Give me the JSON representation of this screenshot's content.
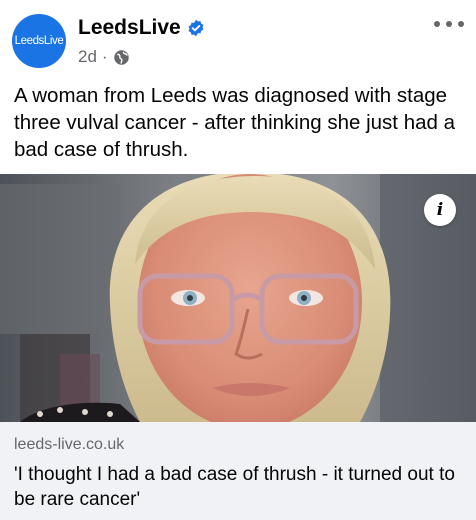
{
  "post": {
    "avatar_text": "LeedsLive",
    "page_name": "LeedsLive",
    "time": "2d",
    "meta_separator": "·",
    "caption": "A woman from Leeds was diagnosed with stage three vulval cancer - after thinking she just had a bad case of thrush."
  },
  "link_preview": {
    "domain": "leeds-live.co.uk",
    "title": "'I thought I had a bad case of thrush - it turned out to be rare cancer'"
  },
  "icons": {
    "verified": "verified-badge-icon",
    "audience": "globe-icon",
    "more": "more-options-icon",
    "info": "info-icon"
  },
  "colors": {
    "brand_blue": "#1b74e4",
    "secondary_text": "#65676b",
    "link_bg": "#f0f2f5"
  }
}
